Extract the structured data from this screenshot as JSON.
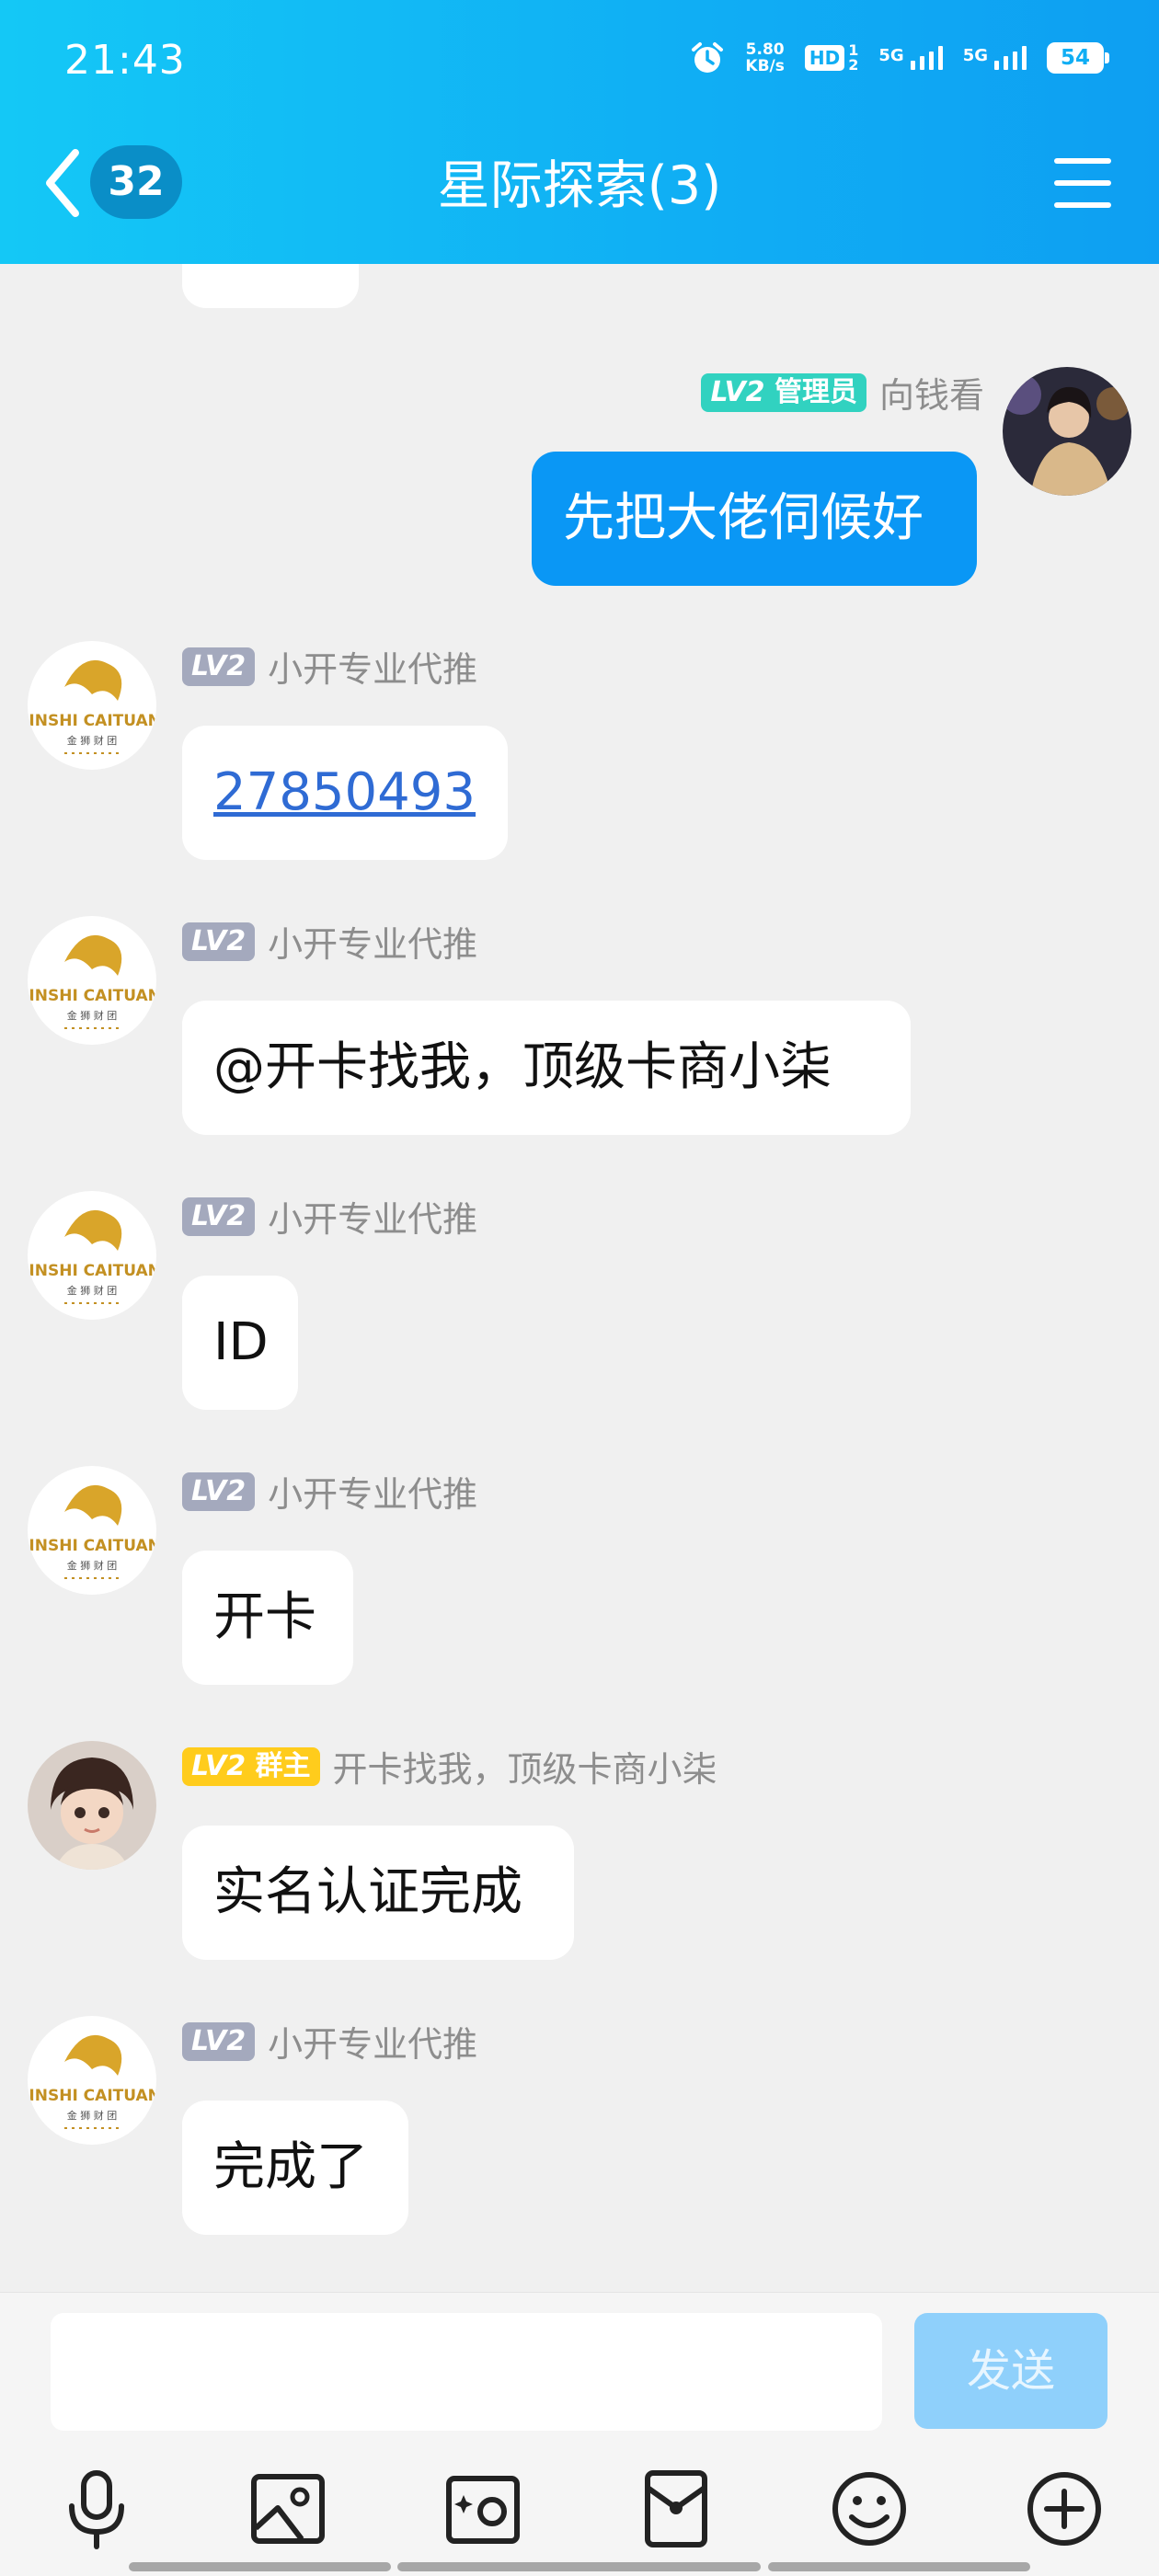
{
  "status_bar": {
    "time": "21:43",
    "net_speed_value": "5.80",
    "net_speed_unit": "KB/s",
    "hd_label": "HD",
    "sim1_label": "5G",
    "sim2_label": "5G",
    "battery": "54"
  },
  "header": {
    "unread_count": "32",
    "title": "星际探索(3)"
  },
  "messages": [
    {
      "sender": "向钱看",
      "level": "LV2",
      "role": "管理员",
      "text": "先把大佬伺候好",
      "mine": true
    },
    {
      "sender": "小开专业代推",
      "level": "LV2",
      "text": "27850493",
      "is_link": true
    },
    {
      "sender": "小开专业代推",
      "level": "LV2",
      "text": "@开卡找我，顶级卡商小柒"
    },
    {
      "sender": "小开专业代推",
      "level": "LV2",
      "text": "ID"
    },
    {
      "sender": "小开专业代推",
      "level": "LV2",
      "text": "开卡"
    },
    {
      "sender": "开卡找我，顶级卡商小柒",
      "level": "LV2",
      "role": "群主",
      "text": "实名认证完成"
    },
    {
      "sender": "小开专业代推",
      "level": "LV2",
      "text": "完成了"
    }
  ],
  "avatar_logo": {
    "line1": "JINSHI CAITUAN",
    "line2": "金 狮 财 团"
  },
  "input": {
    "placeholder": "",
    "send_label": "发送"
  },
  "toolbar": [
    "microphone-icon",
    "image-icon",
    "camera-icon",
    "red-packet-icon",
    "emoji-icon",
    "plus-icon"
  ],
  "colors": {
    "header": "#10aef4",
    "my_bubble": "#0a97f5",
    "admin_badge": "#31d2c0",
    "owner_badge": "#ffcc1c",
    "level_badge": "#a4a9bd",
    "link": "#2f6bd4"
  }
}
